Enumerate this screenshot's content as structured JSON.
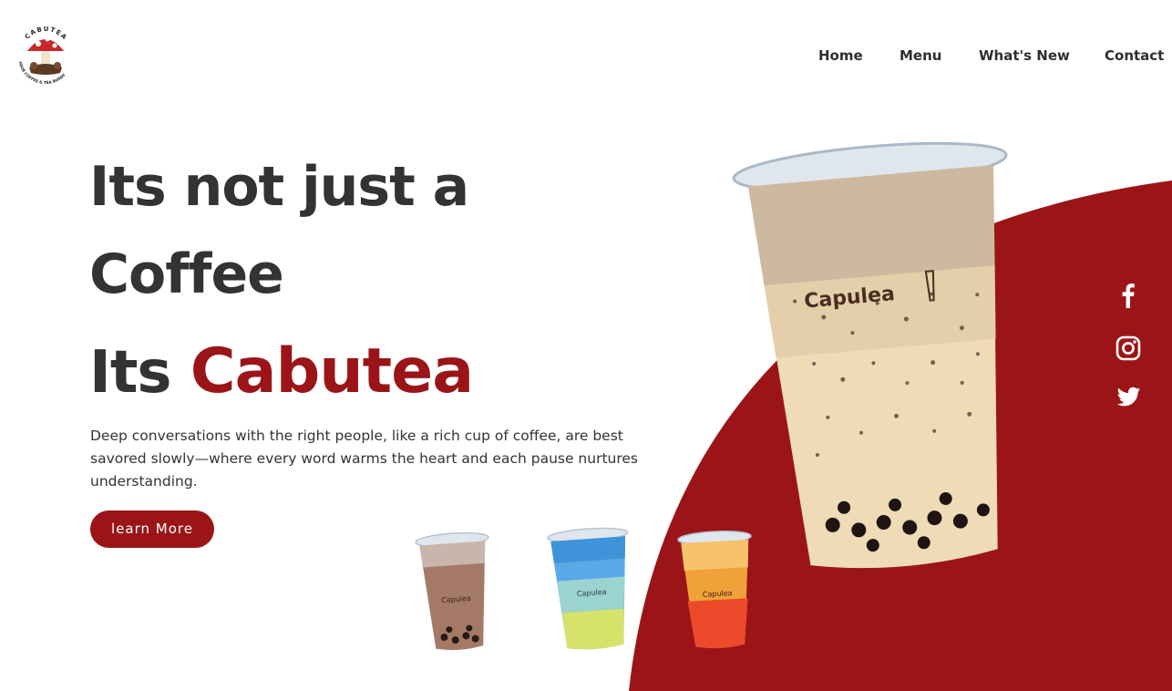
{
  "brand": {
    "logo_text_top": "CABUTEA",
    "logo_text_bottom": "YOUR COFFEE & TEA BUDDY",
    "accent_color": "#9b1518"
  },
  "nav": {
    "items": [
      {
        "label": "Home"
      },
      {
        "label": "Menu"
      },
      {
        "label": "What's New"
      },
      {
        "label": "Contact"
      }
    ]
  },
  "hero": {
    "line1": "Its not just a",
    "line2": "Coffee",
    "line3_prefix": "Its ",
    "line3_accent": "Cabutea",
    "description": "Deep conversations with the right people, like a rich cup of coffee, are best savored slowly—where every word warms the heart and each pause nurtures understanding.",
    "cta_label": "learn More"
  },
  "products": {
    "cup_label": "Capulea"
  },
  "social": [
    {
      "icon": "facebook-icon"
    },
    {
      "icon": "instagram-icon"
    },
    {
      "icon": "twitter-icon"
    }
  ]
}
